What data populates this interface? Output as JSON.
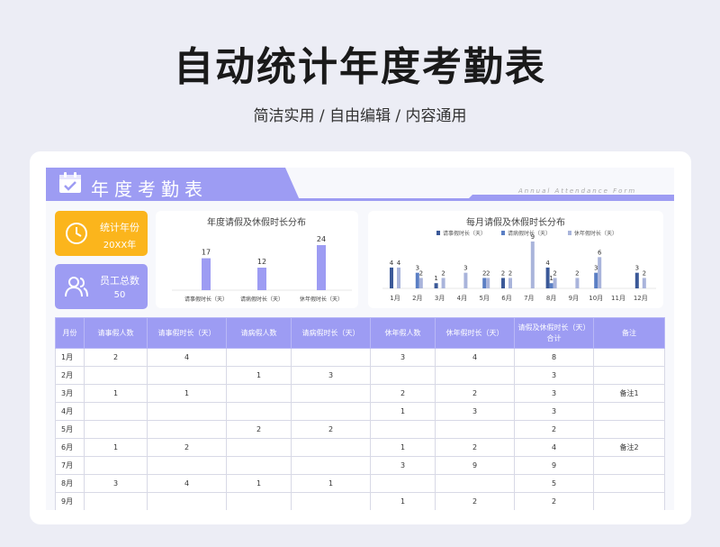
{
  "page": {
    "title": "自动统计年度考勤表",
    "subtitle": "简洁实用 / 自由编辑 / 内容通用"
  },
  "banner": {
    "title": "年度考勤表",
    "english": "Annual Attendance Form"
  },
  "stats": {
    "year_label": "统计年份",
    "year_value": "20XX年",
    "employees_label": "员工总数",
    "employees_value": "50"
  },
  "colors": {
    "accent": "#9d9cf3",
    "yellow": "#fbb51c",
    "dark_bar": "#3b5998",
    "mid_bar": "#5b7fc4",
    "light_bar": "#a9b4db"
  },
  "icons": {
    "banner": "calendar-check-icon",
    "year": "clock-icon",
    "employees": "users-icon"
  },
  "chart_data": [
    {
      "type": "bar",
      "title": "年度请假及休假时长分布",
      "categories": [
        "请事假时长（天）",
        "请病假时长（天）",
        "休年假时长（天）"
      ],
      "values": [
        17,
        12,
        24
      ],
      "ylim": [
        0,
        24
      ],
      "grid": false,
      "legend": "none"
    },
    {
      "type": "bar",
      "title": "每月请假及休假时长分布",
      "categories": [
        "1月",
        "2月",
        "3月",
        "4月",
        "5月",
        "6月",
        "7月",
        "8月",
        "9月",
        "10月",
        "11月",
        "12月"
      ],
      "series": [
        {
          "name": "请事假时长（天）",
          "values": [
            4,
            null,
            1,
            null,
            null,
            2,
            null,
            4,
            null,
            null,
            null,
            3
          ]
        },
        {
          "name": "请病假时长（天）",
          "values": [
            null,
            3,
            null,
            null,
            2,
            null,
            null,
            1,
            null,
            3,
            null,
            null
          ]
        },
        {
          "name": "休年假时长（天）",
          "values": [
            4,
            2,
            2,
            3,
            2,
            2,
            9,
            2,
            2,
            6,
            null,
            2
          ]
        }
      ],
      "ylim": [
        0,
        9
      ],
      "grid": false,
      "legend": "top"
    }
  ],
  "table": {
    "headers": [
      "月份",
      "请事假人数",
      "请事假时长（天）",
      "请病假人数",
      "请病假时长（天）",
      "休年假人数",
      "休年假时长（天）",
      "请假及休假时长（天）合计",
      "备注"
    ],
    "rows": [
      [
        "1月",
        "2",
        "4",
        "",
        "",
        "3",
        "4",
        "8",
        ""
      ],
      [
        "2月",
        "",
        "",
        "1",
        "3",
        "",
        "",
        "3",
        ""
      ],
      [
        "3月",
        "1",
        "1",
        "",
        "",
        "2",
        "2",
        "3",
        "备注1"
      ],
      [
        "4月",
        "",
        "",
        "",
        "",
        "1",
        "3",
        "3",
        ""
      ],
      [
        "5月",
        "",
        "",
        "2",
        "2",
        "",
        "",
        "2",
        ""
      ],
      [
        "6月",
        "1",
        "2",
        "",
        "",
        "1",
        "2",
        "4",
        "备注2"
      ],
      [
        "7月",
        "",
        "",
        "",
        "",
        "3",
        "9",
        "9",
        ""
      ],
      [
        "8月",
        "3",
        "4",
        "1",
        "1",
        "",
        "",
        "5",
        ""
      ],
      [
        "9月",
        "",
        "",
        "",
        "",
        "1",
        "2",
        "2",
        ""
      ]
    ]
  }
}
